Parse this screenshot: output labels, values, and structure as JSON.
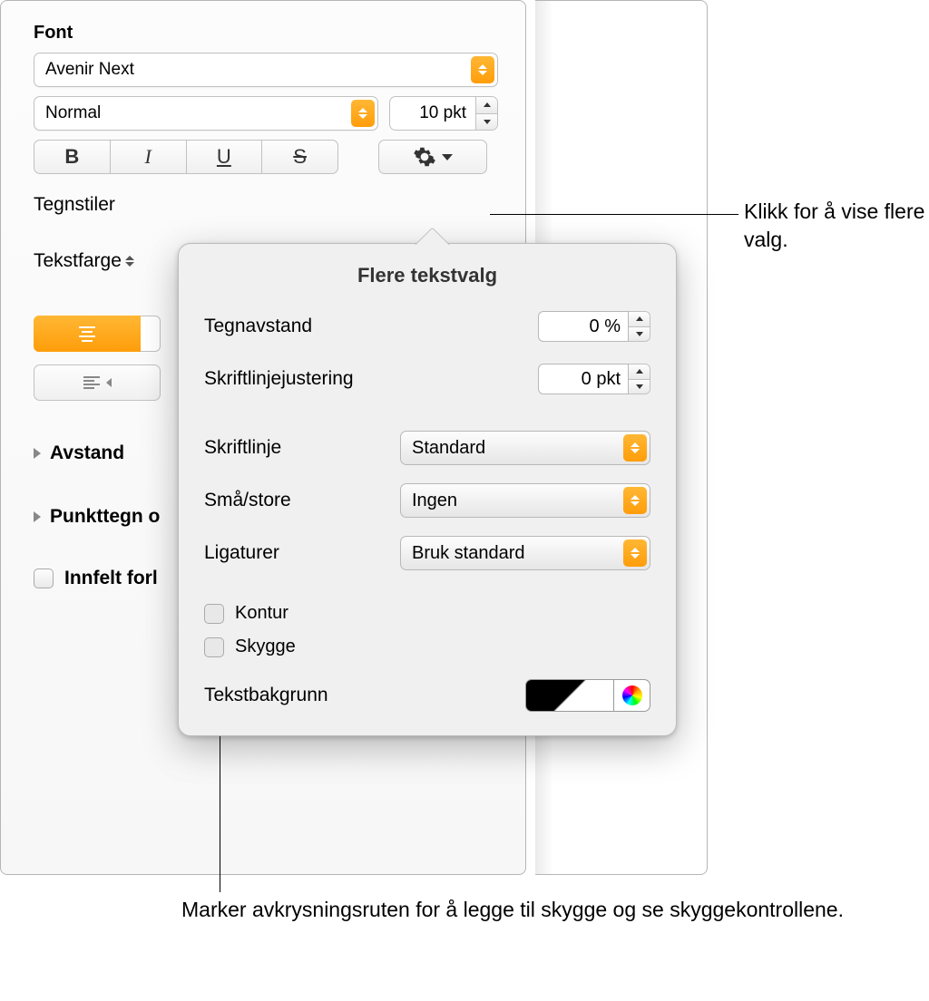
{
  "sidebar": {
    "section_font": "Font",
    "font_family": "Avenir Next",
    "font_style": "Normal",
    "font_size": "10 pkt",
    "char_styles": "Tegnstiler",
    "text_color": "Tekstfarge",
    "spacing": "Avstand",
    "bullets": "Punkttegn o",
    "drop_cap": "Innfelt forl"
  },
  "popover": {
    "title": "Flere tekstvalg",
    "char_spacing_label": "Tegnavstand",
    "char_spacing_value": "0 %",
    "baseline_shift_label": "Skriftlinjejustering",
    "baseline_shift_value": "0 pkt",
    "baseline_label": "Skriftlinje",
    "baseline_value": "Standard",
    "caps_label": "Små/store",
    "caps_value": "Ingen",
    "ligatures_label": "Ligaturer",
    "ligatures_value": "Bruk standard",
    "outline_label": "Kontur",
    "shadow_label": "Skygge",
    "text_bg_label": "Tekstbakgrunn"
  },
  "callouts": {
    "gear": "Klikk for å vise flere valg.",
    "shadow": "Marker avkrysningsruten for å legge til skygge og se skyggekontrollene."
  }
}
